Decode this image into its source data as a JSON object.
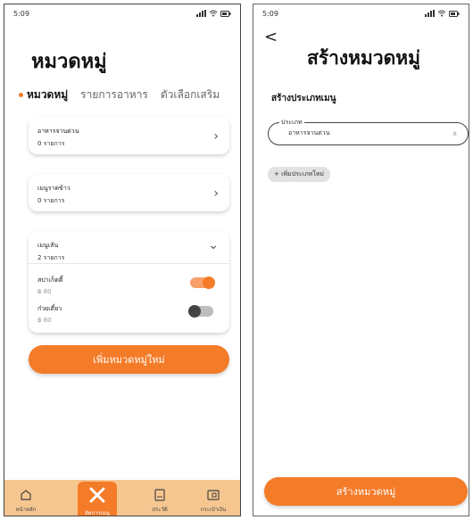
{
  "left": {
    "status": {
      "time": "5:09"
    },
    "title": "หมวดหมู่",
    "tabs": [
      {
        "label": "หมวดหมู่",
        "active": true
      },
      {
        "label": "รายการอาหาร",
        "active": false
      },
      {
        "label": "ตัวเลือกเสริม",
        "active": false
      }
    ],
    "categories": [
      {
        "name": "อาหารจานด่วน",
        "count": "0 รายการ"
      },
      {
        "name": "เมนูราดข้าว",
        "count": "0 รายการ"
      },
      {
        "name": "เมนูเส้น",
        "count": "2 รายการ",
        "items": [
          {
            "name": "สปาเก็ตตี้",
            "price": "฿ 80",
            "enabled": true
          },
          {
            "name": "ก๋วยเตี๋ยว",
            "price": "฿ 80",
            "enabled": false
          }
        ]
      }
    ],
    "add_button": "เพิ่มหมวดหมู่ใหม่",
    "nav": [
      {
        "label": "หน้าหลัก",
        "icon": "home-icon",
        "active": false
      },
      {
        "label": "จัดการเมนู",
        "icon": "utensils-icon",
        "active": true
      },
      {
        "label": "ประวัติ",
        "icon": "document-icon",
        "active": false
      },
      {
        "label": "กระเป๋าเงิน",
        "icon": "wallet-icon",
        "active": false
      }
    ]
  },
  "right": {
    "status": {
      "time": "5:09"
    },
    "back": "<",
    "title": "สร้างหมวดหมู่",
    "section_label": "สร้างประเภทเมนู",
    "field": {
      "legend": "ประเภท",
      "value": "อาหารจานด่วน",
      "clear": "x"
    },
    "chip": "+ เพิ่มประเภทใหม่",
    "submit": "สร้างหมวดหมู่"
  },
  "colors": {
    "accent": "#f47b28",
    "nav_bg": "#f6c690",
    "toggle_off": "#444444"
  }
}
